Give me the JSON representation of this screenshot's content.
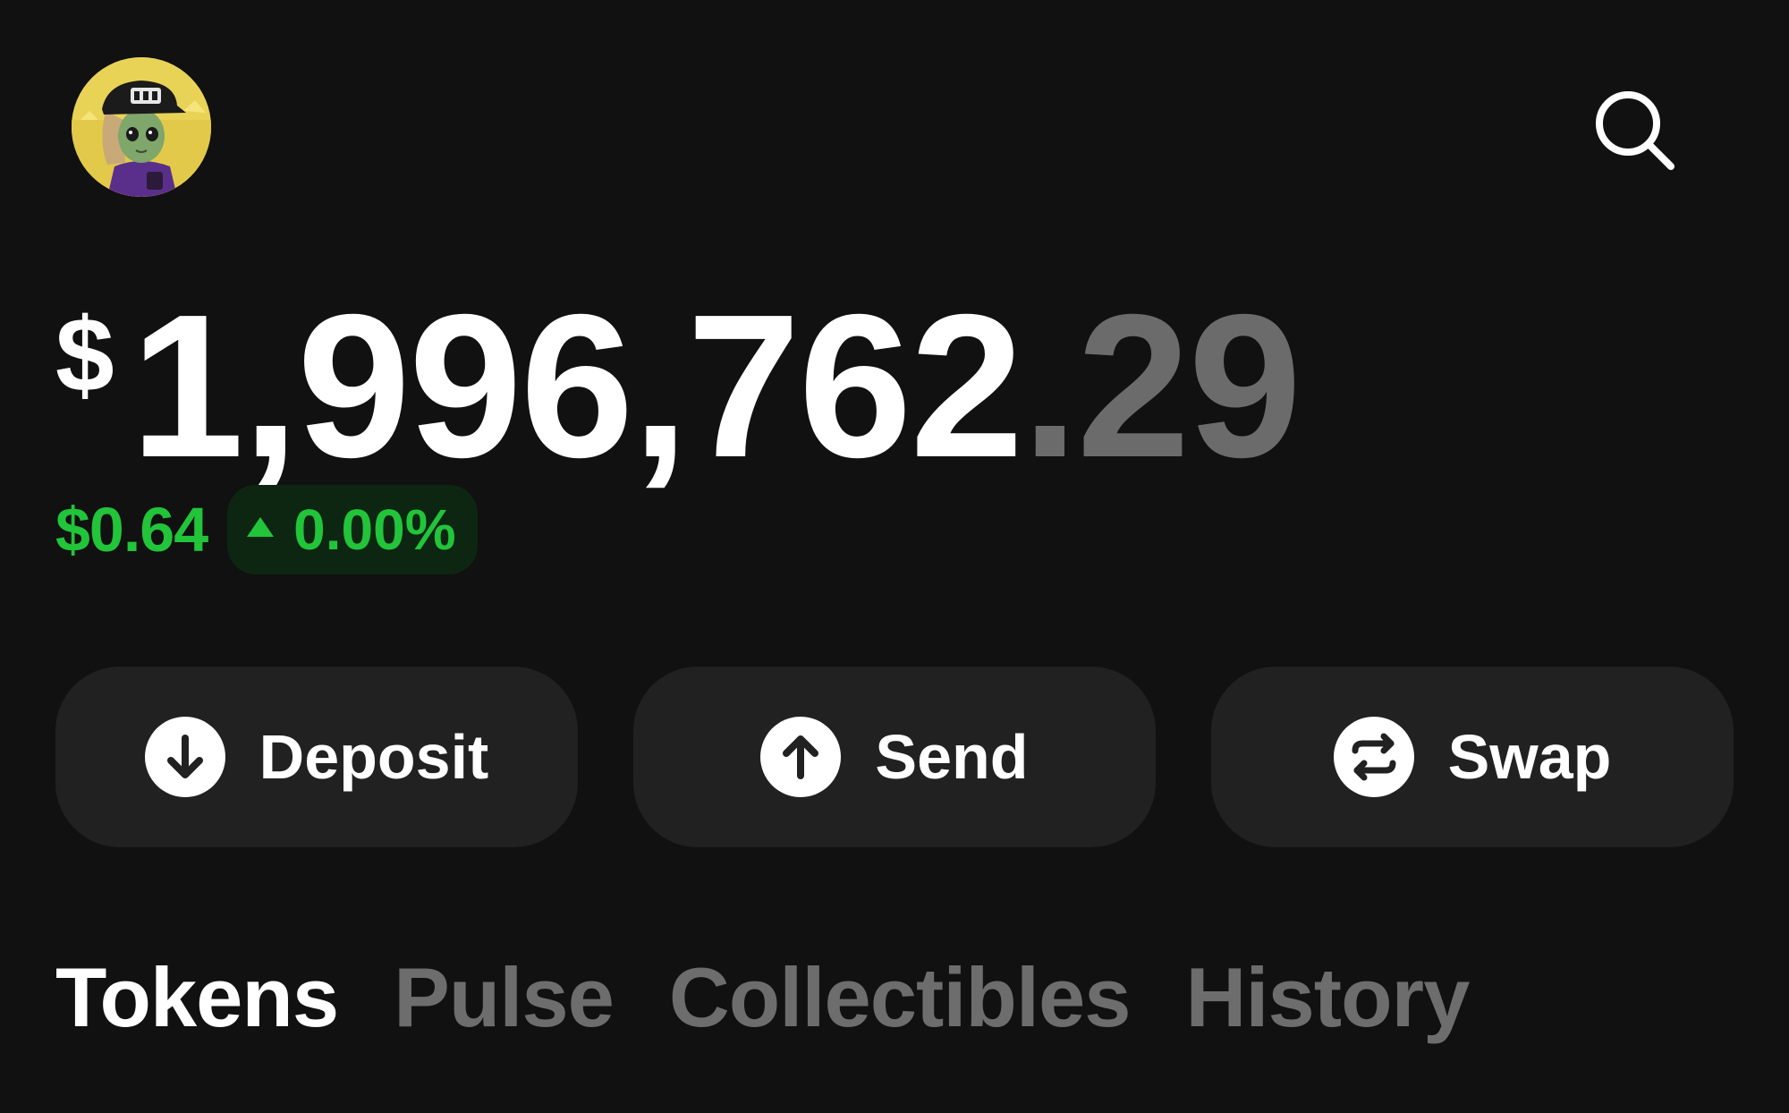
{
  "header": {
    "avatar_icon": "user-avatar-image",
    "search_icon": "search-icon"
  },
  "balance": {
    "currency_symbol": "$",
    "whole": "1,996,762",
    "decimal": ".29"
  },
  "change": {
    "amount": "$0.64",
    "direction_icon": "triangle-up-icon",
    "percent": "0.00%",
    "color": "#22c43a"
  },
  "actions": [
    {
      "label": "Deposit",
      "icon": "arrow-down-circle-icon"
    },
    {
      "label": "Send",
      "icon": "arrow-up-circle-icon"
    },
    {
      "label": "Swap",
      "icon": "swap-arrows-circle-icon"
    }
  ],
  "tabs": [
    {
      "label": "Tokens",
      "active": true
    },
    {
      "label": "Pulse",
      "active": false
    },
    {
      "label": "Collectibles",
      "active": false
    },
    {
      "label": "History",
      "active": false
    }
  ],
  "colors": {
    "background": "#111111",
    "button_bg": "#212121",
    "inactive_tab": "#6d6d6d",
    "positive": "#22c43a",
    "positive_pill_bg": "#0c2612"
  }
}
